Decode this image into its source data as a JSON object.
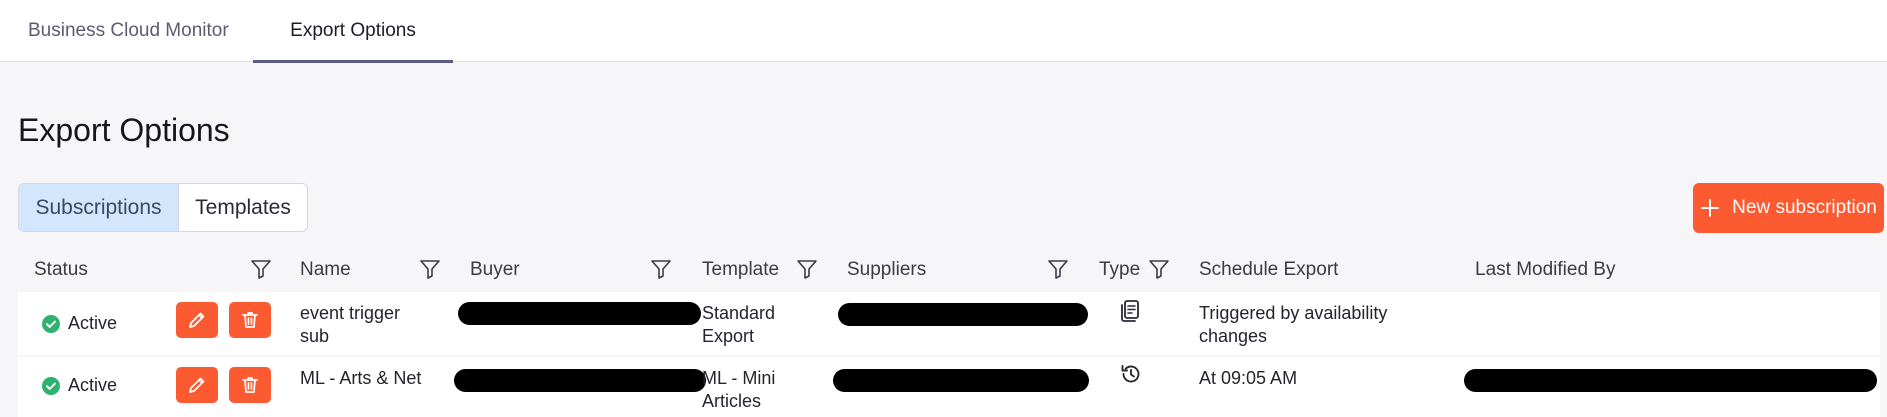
{
  "top_tabs": [
    {
      "label": "Business Cloud Monitor"
    },
    {
      "label": "Export Options"
    }
  ],
  "page_title": "Export Options",
  "segments": [
    {
      "label": "Subscriptions",
      "active": true
    },
    {
      "label": "Templates",
      "active": false
    }
  ],
  "new_button_label": "New subscription",
  "columns": {
    "status": "Status",
    "name": "Name",
    "buyer": "Buyer",
    "template": "Template",
    "suppliers": "Suppliers",
    "type": "Type",
    "schedule": "Schedule Export",
    "last_modified": "Last Modified By"
  },
  "rows": [
    {
      "status": "Active",
      "name": "event trigger sub",
      "template": "Standard Export",
      "type_icon": "document-trigger-icon",
      "schedule": "Triggered by availability changes"
    },
    {
      "status": "Active",
      "name": "ML - Arts & Net",
      "template": "ML - Mini Articles",
      "type_icon": "scheduled-clock-icon",
      "schedule": "At 09:05 AM"
    }
  ],
  "colors": {
    "accent": "#fc5a31",
    "active_tab_underline": "#5d5b80",
    "status_active": "#2fb170",
    "segment_active_bg": "#d4e6fb"
  }
}
